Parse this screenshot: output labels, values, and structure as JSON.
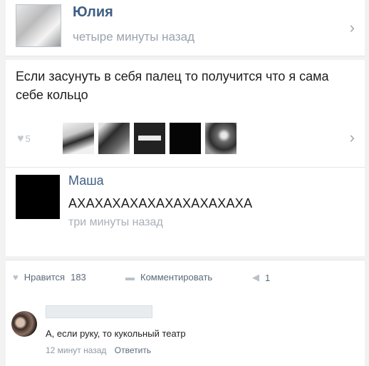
{
  "post": {
    "author": "Юлия",
    "time": "четыре минуты назад",
    "text": "Если засунуть в себя палец то получится что я сама себе кольцо",
    "likes_count": "5",
    "chevron": "›"
  },
  "reply": {
    "author": "Маша",
    "text": "АХАХАХАХАХАХАХАХАХАХА",
    "time": "три минуты назад"
  },
  "actions": {
    "like_label": "Нравится",
    "like_count": "183",
    "comment_label": "Комментировать",
    "share_count": "1"
  },
  "comment": {
    "text": "А, если руку, то кукольный театр",
    "time": "12 минут назад",
    "reply_label": "Ответить"
  },
  "icons": {
    "heart": "heart-icon",
    "comment": "comment-icon",
    "share": "share-icon",
    "chevron": "chevron-right-icon"
  }
}
